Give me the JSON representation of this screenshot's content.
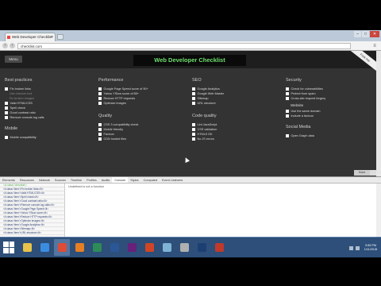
{
  "browser": {
    "tab_title": "Web Developer Checklist",
    "tab_close": "×",
    "url": "checklist.com",
    "window_buttons": {
      "minimize": "–",
      "maximize": "□",
      "close": "✕"
    }
  },
  "page": {
    "menu_label": "Menu",
    "title": "Web Developer Checklist",
    "ribbon": "Fork me",
    "columns": [
      {
        "heading": "Best practices",
        "items": [
          "Fix broken links",
          "Valid HTML/CSS",
          "Spell check",
          "Good contrast ratio",
          "Remove console.log calls"
        ],
        "sub_items": [
          "Use checker tool",
          "Fix broken images"
        ]
      },
      {
        "heading": "Performance",
        "items": [
          "Google Page Speed score of 90+",
          "Yahoo YSlow score of 85+",
          "Reduce HTTP requests",
          "Optimize images"
        ]
      },
      {
        "heading": "SEO",
        "items": [
          "Google Analytics",
          "Google Web Master",
          "Sitemap",
          "URL structure"
        ]
      },
      {
        "heading": "Security",
        "items": [
          "Check for vulnerabilities",
          "Protect from spam",
          "Cross-site request forgery"
        ]
      }
    ],
    "quality": {
      "heading": "Quality",
      "items": [
        "CSS 3 compatibility check",
        "Mobile friendly",
        "Favicon",
        "CDN hosted files"
      ]
    },
    "code_quality": {
      "heading": "Code quality",
      "items": [
        "Lint JavaScript",
        "CSS validation",
        "HTML5 OK",
        "No JS errors"
      ]
    },
    "mobile": {
      "heading": "Mobile",
      "items": [
        "Mobile compatibility",
        "Touch friendly"
      ]
    },
    "social": {
      "heading": "Social Media",
      "items": [
        "Open Graph data"
      ]
    },
    "extra": {
      "sub_heading": "Website",
      "items": [
        "Use the same domain",
        "Include a favicon"
      ]
    },
    "status": "Done"
  },
  "devtools": {
    "tabs": [
      "Elements",
      "Resources",
      "Network",
      "Sources",
      "Timeline",
      "Profiles",
      "Audits",
      "Console",
      "Styles",
      "Computed",
      "Event Listeners"
    ],
    "active_tab": "Console",
    "lines": [
      "<ul class='checklist'>",
      "<li class='item'>Fix broken links</li>",
      "<li class='item'>Valid HTML/CSS</li>",
      "<li class='item'>Spell check</li>",
      "<li class='item'>Good contrast ratio</li>",
      "<li class='item'>Remove console.log calls</li>",
      "<li class='item'>Google Page Speed</li>",
      "<li class='item'>Yahoo YSlow score</li>",
      "<li class='item'>Reduce HTTP requests</li>",
      "<li class='item'>Optimize images</li>",
      "<li class='item'>Google Analytics</li>",
      "<li class='item'>Sitemap</li>",
      "<li class='item'>URL structure</li>"
    ],
    "right_text": "Undefined is not a function"
  },
  "taskbar": {
    "clock_time": "3:55 PM",
    "clock_date": "1/11/2015",
    "apps": [
      {
        "name": "file-explorer",
        "color": "#e8c24a"
      },
      {
        "name": "ie",
        "color": "#3b8de0"
      },
      {
        "name": "chrome",
        "color": "#dd4b39"
      },
      {
        "name": "firefox",
        "color": "#e67e22"
      },
      {
        "name": "excel",
        "color": "#2e8b57"
      },
      {
        "name": "word",
        "color": "#2b5797"
      },
      {
        "name": "visual-studio",
        "color": "#68217a"
      },
      {
        "name": "powerpoint",
        "color": "#d04525"
      },
      {
        "name": "notepad",
        "color": "#7fb3d5"
      },
      {
        "name": "sql",
        "color": "#b0b0b0"
      },
      {
        "name": "photoshop",
        "color": "#1c3f73"
      },
      {
        "name": "filezilla",
        "color": "#c0392b"
      }
    ]
  }
}
